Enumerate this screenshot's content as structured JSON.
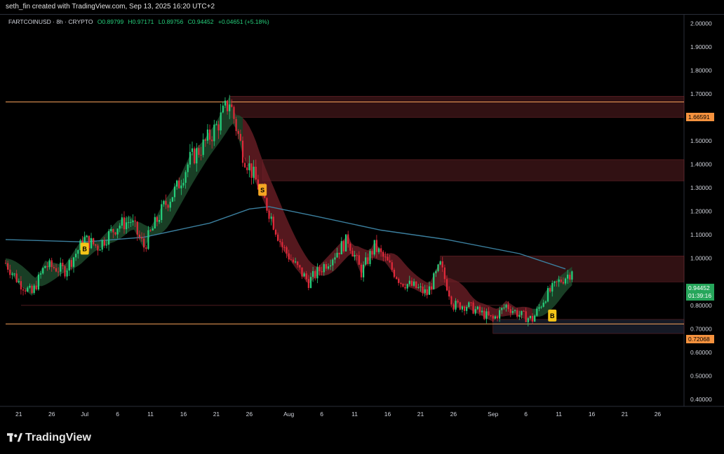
{
  "header": {
    "attribution": "seth_fin created with TradingView.com, Sep 13, 2025 16:20 UTC+2"
  },
  "legend": {
    "symbol": "FARTCOINUSD · 8h · CRYPTO",
    "open": "O0.89799",
    "high": "H0.97171",
    "low": "L0.89756",
    "close": "C0.94452",
    "change": "+0.04651 (+5.18%)"
  },
  "price_labels": {
    "resistance": "1.66591",
    "current": "0.94452",
    "countdown": "01:39:16",
    "support": "0.72068"
  },
  "signals": [
    {
      "label": "B",
      "color": "#f5c518"
    },
    {
      "label": "S",
      "color": "#f5a623"
    },
    {
      "label": "B",
      "color": "#f5c518"
    }
  ],
  "footer": {
    "brand": "TradingView"
  },
  "colors": {
    "up": "#26d07c",
    "down": "#e0293a",
    "ma": "#3b7f9e",
    "resistance_line": "#f5a05a",
    "support_line": "#f5a05a",
    "zone": "#5a1f23",
    "current_tag": "#26a65b",
    "level_tag": "#f5923e"
  },
  "chart_data": {
    "type": "candlestick",
    "y_axis": {
      "ticks": [
        "2.00000",
        "1.90000",
        "1.80000",
        "1.70000",
        "1.60000",
        "1.50000",
        "1.40000",
        "1.30000",
        "1.20000",
        "1.10000",
        "1.00000",
        "0.80000",
        "0.70000",
        "0.60000",
        "0.50000",
        "0.40000"
      ],
      "tick_values": [
        2.0,
        1.9,
        1.8,
        1.7,
        1.6,
        1.5,
        1.4,
        1.3,
        1.2,
        1.1,
        1.0,
        0.8,
        0.7,
        0.6,
        0.5,
        0.4
      ],
      "ylim": [
        0.37,
        2.04
      ]
    },
    "x_axis": {
      "ticks": [
        "21",
        "26",
        "Jul",
        "6",
        "11",
        "16",
        "21",
        "26",
        "Aug",
        "6",
        "11",
        "16",
        "21",
        "26",
        "Sep",
        "6",
        "11",
        "16",
        "21",
        "26"
      ],
      "xlim": [
        "2025-06-19",
        "2025-09-30"
      ]
    },
    "levels": {
      "resistance": 1.66591,
      "support": 0.72068,
      "current": 0.94452
    },
    "zones": [
      {
        "y": [
          1.6,
          1.69
        ]
      },
      {
        "y": [
          1.33,
          1.42
        ]
      },
      {
        "y": [
          0.9,
          1.01
        ]
      },
      {
        "y": [
          0.68,
          0.74
        ]
      }
    ],
    "trend": [
      {
        "date": "2025-06-19",
        "price": 0.98
      },
      {
        "date": "2025-06-21",
        "price": 0.9
      },
      {
        "date": "2025-06-23",
        "price": 0.85
      },
      {
        "date": "2025-06-25",
        "price": 0.97
      },
      {
        "date": "2025-06-28",
        "price": 0.95
      },
      {
        "date": "2025-07-01",
        "price": 1.08
      },
      {
        "date": "2025-07-03",
        "price": 1.05
      },
      {
        "date": "2025-07-06",
        "price": 1.14
      },
      {
        "date": "2025-07-08",
        "price": 1.16
      },
      {
        "date": "2025-07-10",
        "price": 1.05
      },
      {
        "date": "2025-07-13",
        "price": 1.22
      },
      {
        "date": "2025-07-15",
        "price": 1.3
      },
      {
        "date": "2025-07-17",
        "price": 1.42
      },
      {
        "date": "2025-07-19",
        "price": 1.48
      },
      {
        "date": "2025-07-21",
        "price": 1.56
      },
      {
        "date": "2025-07-23",
        "price": 1.67
      },
      {
        "date": "2025-07-25",
        "price": 1.45
      },
      {
        "date": "2025-07-27",
        "price": 1.33
      },
      {
        "date": "2025-07-29",
        "price": 1.2
      },
      {
        "date": "2025-07-31",
        "price": 1.05
      },
      {
        "date": "2025-08-02",
        "price": 0.97
      },
      {
        "date": "2025-08-04",
        "price": 0.9
      },
      {
        "date": "2025-08-06",
        "price": 0.96
      },
      {
        "date": "2025-08-08",
        "price": 1.02
      },
      {
        "date": "2025-08-10",
        "price": 1.08
      },
      {
        "date": "2025-08-12",
        "price": 0.94
      },
      {
        "date": "2025-08-14",
        "price": 1.05
      },
      {
        "date": "2025-08-16",
        "price": 0.98
      },
      {
        "date": "2025-08-18",
        "price": 0.9
      },
      {
        "date": "2025-08-20",
        "price": 0.88
      },
      {
        "date": "2025-08-22",
        "price": 0.85
      },
      {
        "date": "2025-08-24",
        "price": 0.97
      },
      {
        "date": "2025-08-26",
        "price": 0.8
      },
      {
        "date": "2025-08-28",
        "price": 0.8
      },
      {
        "date": "2025-08-30",
        "price": 0.77
      },
      {
        "date": "2025-09-01",
        "price": 0.74
      },
      {
        "date": "2025-09-03",
        "price": 0.8
      },
      {
        "date": "2025-09-05",
        "price": 0.76
      },
      {
        "date": "2025-09-07",
        "price": 0.74
      },
      {
        "date": "2025-09-09",
        "price": 0.84
      },
      {
        "date": "2025-09-11",
        "price": 0.9
      },
      {
        "date": "2025-09-13",
        "price": 0.94452
      }
    ],
    "moving_average": [
      {
        "date": "2025-06-19",
        "price": 1.08
      },
      {
        "date": "2025-07-01",
        "price": 1.07
      },
      {
        "date": "2025-07-10",
        "price": 1.09
      },
      {
        "date": "2025-07-20",
        "price": 1.15
      },
      {
        "date": "2025-07-26",
        "price": 1.21
      },
      {
        "date": "2025-07-29",
        "price": 1.22
      },
      {
        "date": "2025-08-05",
        "price": 1.18
      },
      {
        "date": "2025-08-15",
        "price": 1.12
      },
      {
        "date": "2025-08-25",
        "price": 1.08
      },
      {
        "date": "2025-09-05",
        "price": 1.02
      },
      {
        "date": "2025-09-12",
        "price": 0.955
      }
    ],
    "signal_points": [
      {
        "label": "B",
        "date": "2025-07-01",
        "price": 1.04
      },
      {
        "label": "S",
        "date": "2025-07-28",
        "price": 1.29
      },
      {
        "label": "B",
        "date": "2025-09-10",
        "price": 0.755
      }
    ]
  }
}
